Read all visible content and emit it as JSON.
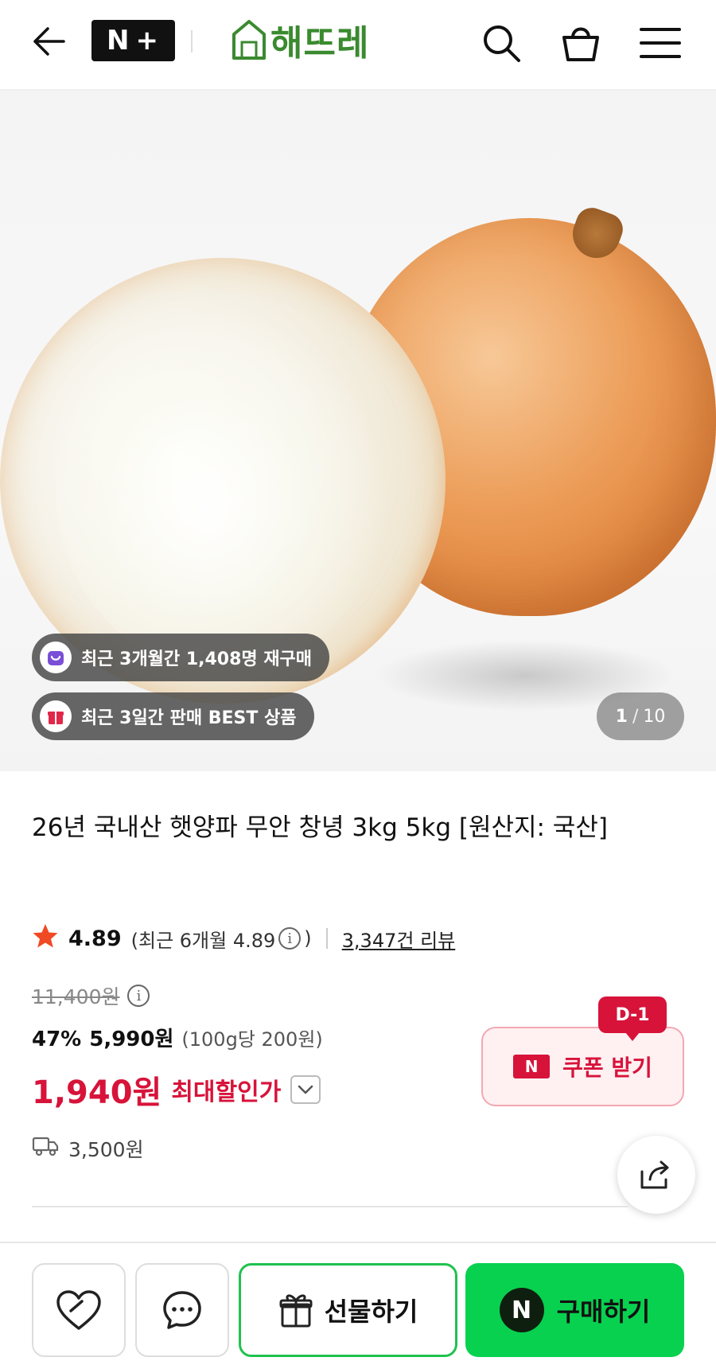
{
  "header": {
    "back_icon": "arrow-left-icon",
    "nplus_text": "N",
    "nplus_plus": "+",
    "logo_text": "해뜨레",
    "search_icon": "search-icon",
    "cart_icon": "shopping-bag-icon",
    "menu_icon": "hamburger-menu-icon"
  },
  "gallery": {
    "badges": [
      {
        "text": "최근 3개월간 1,408명 재구매",
        "icon": "repurchase-bag-icon",
        "color": "#7a4fd6"
      },
      {
        "text": "최근 3일간 판매 BEST 상품",
        "icon": "gift-box-icon",
        "color": "#e0284a"
      }
    ],
    "counter_current": "1",
    "counter_sep": "/",
    "counter_total": "10"
  },
  "product": {
    "title": "26년 국내산 햇양파 무안 창녕 3kg 5kg [원산지: 국산]",
    "rating": {
      "score": "4.89",
      "recent_label": "(최근 6개월 4.89",
      "recent_close": ")",
      "info_icon": "info-icon",
      "review_count": "3,347건 리뷰",
      "star_color": "#f04a24"
    },
    "original_price": "11,400원",
    "discount_pct": "47%",
    "sale_price": "5,990원",
    "unit_price": "(100g당 200원)",
    "max_discount_price": "1,940원",
    "max_discount_label": "최대할인가",
    "coupon": {
      "dday": "D-1",
      "n_badge": "N",
      "label": "쿠폰 받기"
    },
    "shipping": "3,500원"
  },
  "bottom_bar": {
    "like_icon": "heart-icon",
    "talk_icon": "chat-bubble-icon",
    "gift_label": "선물하기",
    "buy_n": "N",
    "buy_label": "구매하기",
    "buy_color": "#08d14f"
  }
}
